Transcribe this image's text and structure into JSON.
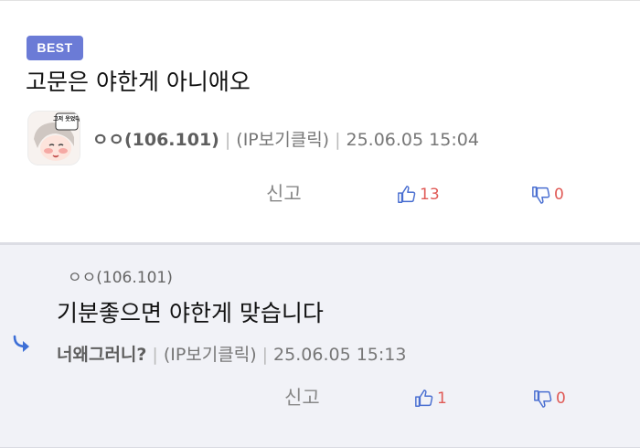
{
  "colors": {
    "best_badge": "#6b7bd6",
    "accent_icon": "#4a6fd1",
    "count": "#e05a56",
    "reply_bg": "#f1f2f7"
  },
  "main_comment": {
    "badge": "BEST",
    "text": "고문은 야한게 아니애오",
    "avatar_text": "그저 웃었다",
    "author": "ㅇㅇ(106.101)",
    "ip_link": "(IP보기클릭)",
    "timestamp": "25.06.05 15:04",
    "report_label": "신고",
    "upvotes": "13",
    "downvotes": "0"
  },
  "reply_comment": {
    "parent_author": "ㅇㅇ(106.101)",
    "text": "기분좋으면 야한게 맞습니다",
    "author": "너왜그러니?",
    "ip_link": "(IP보기클릭)",
    "timestamp": "25.06.05 15:13",
    "report_label": "신고",
    "upvotes": "1",
    "downvotes": "0"
  },
  "icons": {
    "avatar": "avatar-image",
    "upvote": "thumbs-up-icon",
    "downvote": "thumbs-down-icon",
    "reply": "reply-arrow-icon"
  }
}
